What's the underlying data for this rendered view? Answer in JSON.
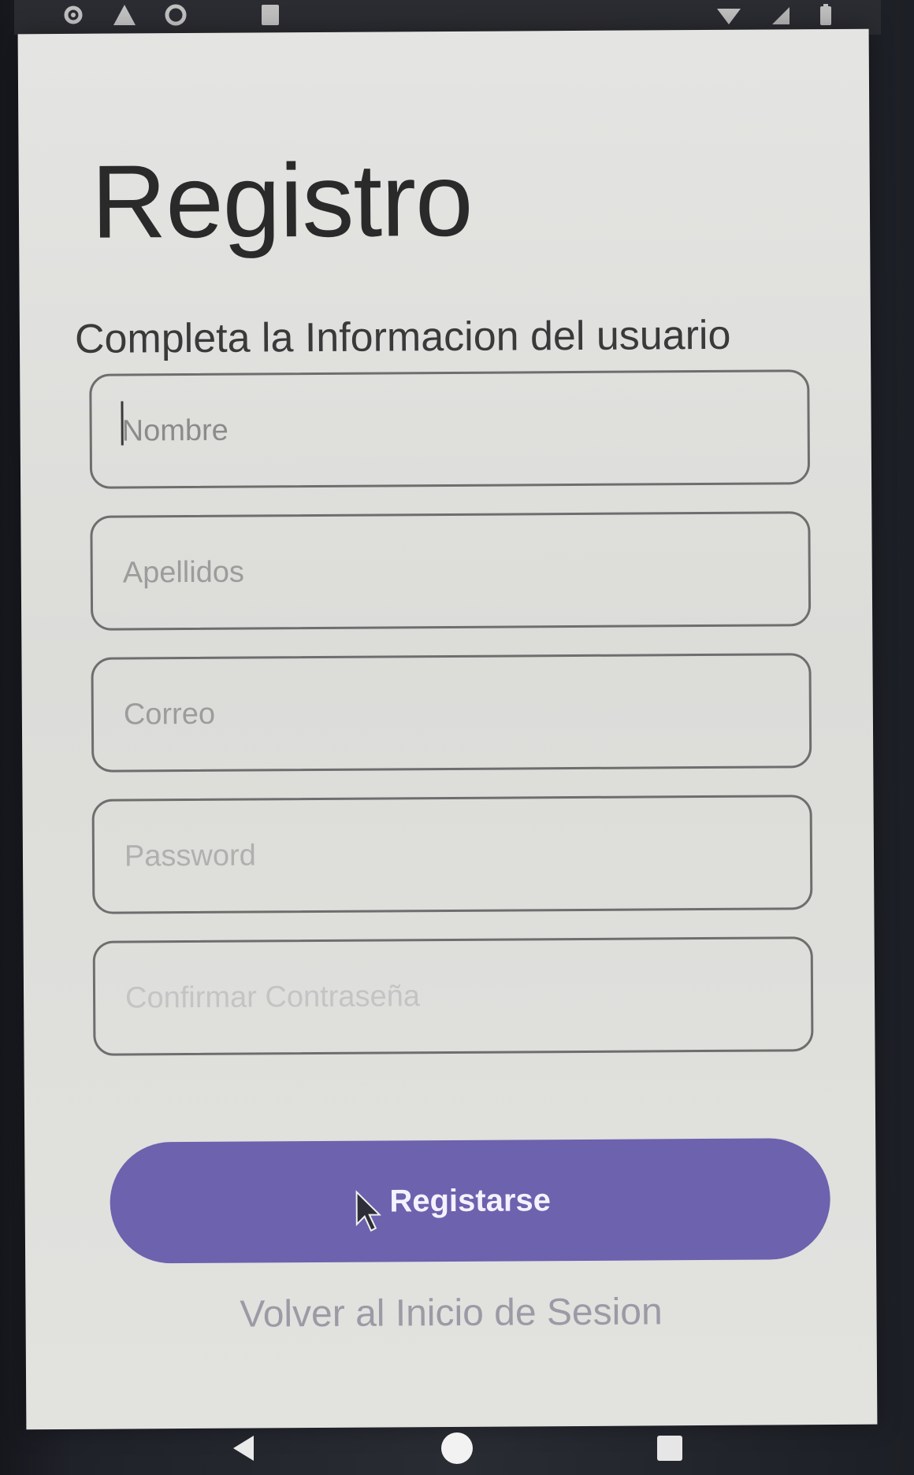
{
  "colors": {
    "screen_bg": "#e0e0dd",
    "primary_button": "#6c62ae",
    "button_text": "#f4f2ff",
    "title_text": "#2a2a2a",
    "link_text": "#9b9ba6",
    "field_border": "#6e6e6e"
  },
  "status_bar": {
    "left_icons": [
      "gear-icon",
      "warning-icon",
      "sync-icon",
      "moon-icon",
      "sd-card-icon"
    ],
    "right_icons": [
      "wifi-icon",
      "signal-icon",
      "battery-icon"
    ]
  },
  "form": {
    "title": "Registro",
    "subtitle": "Completa la Informacion del usuario",
    "fields": [
      {
        "placeholder": "Nombre",
        "value": ""
      },
      {
        "placeholder": "Apellidos",
        "value": ""
      },
      {
        "placeholder": "Correo",
        "value": ""
      },
      {
        "placeholder": "Password",
        "value": ""
      },
      {
        "placeholder": "Confirmar Contraseña",
        "value": ""
      }
    ],
    "submit_label": "Registarse",
    "back_link_label": "Volver al Inicio de Sesion"
  },
  "nav_bar": {
    "buttons": [
      "back-icon",
      "home-icon",
      "recents-icon"
    ]
  }
}
